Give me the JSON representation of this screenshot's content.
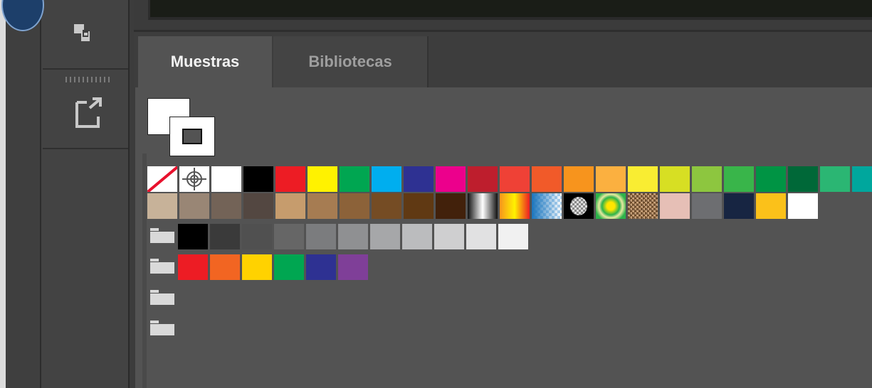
{
  "tabs": {
    "swatches_label": "Muestras",
    "libraries_label": "Bibliotecas"
  },
  "toolbar": {
    "icons": [
      "arrange-icon",
      "popout-icon"
    ]
  },
  "swatches": {
    "row1": [
      "none",
      "registration",
      "#ffffff",
      "#000000",
      "#ed1c24",
      "#fff200",
      "#00a651",
      "#00aeef",
      "#2e3192",
      "#ec008c",
      "#be1e2d",
      "#ef4136",
      "#f15a29",
      "#f7941d",
      "#fbb040",
      "#f9ed32",
      "#d7df23",
      "#8dc63f",
      "#39b54a",
      "#009444",
      "#006838",
      "#2bb673",
      "#00a79d"
    ],
    "row2": [
      "#c7b299",
      "#998675",
      "#736357",
      "#534741",
      "#c69c6d",
      "#a67c52",
      "#8c6239",
      "#754c24",
      "#603913",
      "#42210b",
      "gradient-black-white",
      "gradient-orange-yellow",
      "gradient-blue-check",
      "pattern-dots",
      "pattern-green",
      "pattern-brown",
      "#e6bfb6",
      "#6d6e71",
      "#172542",
      "#fbc11a",
      "#ffffff"
    ],
    "grays_group": [
      "#000000",
      "#3a3a3a",
      "#505050",
      "#666666",
      "#7b7c7e",
      "#8f9092",
      "#a6a7a9",
      "#bbbcbe",
      "#cfcfd0",
      "#e1e1e2",
      "#f1f1f1"
    ],
    "brights_group": [
      "#ed1c24",
      "#f26522",
      "#ffd200",
      "#00a651",
      "#2e3192",
      "#7f3f98"
    ],
    "empty_groups": 2
  }
}
